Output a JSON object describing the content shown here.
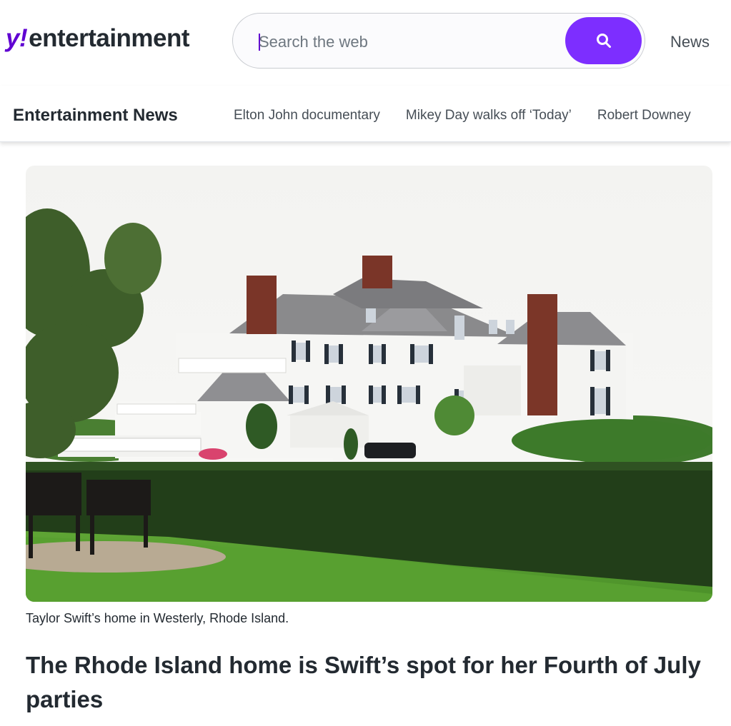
{
  "header": {
    "logo_y": "y",
    "logo_bang": "!",
    "logo_word": "entertainment",
    "search_placeholder": "Search the web",
    "search_button_icon": "search-icon",
    "news_link": "News"
  },
  "nav": {
    "title": "Entertainment News",
    "items": [
      {
        "label": "Elton John documentary"
      },
      {
        "label": "Mikey Day walks off ‘Today’"
      },
      {
        "label": "Robert Downey"
      }
    ]
  },
  "article": {
    "image_caption": "Taylor Swift’s home in Westerly, Rhode Island.",
    "headline": "The Rhode Island home is Swift’s spot for her Fourth of July parties"
  },
  "colors": {
    "accent": "#7d2eff",
    "brand": "#6001d2",
    "text": "#232a31"
  }
}
